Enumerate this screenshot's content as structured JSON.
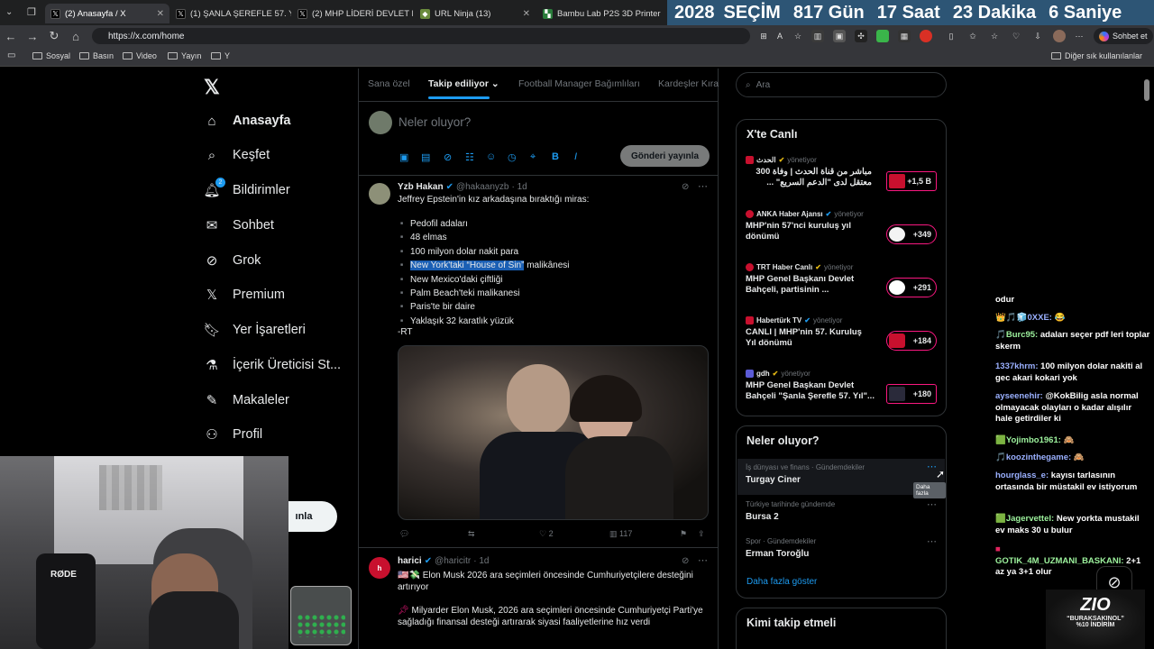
{
  "browser": {
    "tabs": [
      {
        "title": "(2) Anasayfa / X",
        "active": true,
        "favicon": "x-icon"
      },
      {
        "title": "(1) ŞANLA ŞEREFLE 57. YIL /",
        "active": false,
        "favicon": "x-icon"
      },
      {
        "title": "(2) MHP LİDERİ DEVLET BA",
        "active": false,
        "favicon": "x-icon"
      },
      {
        "title": "URL Ninja (13)",
        "active": false,
        "favicon": "ninja-icon"
      },
      {
        "title": "Bambu Lab P2S 3D Printer",
        "active": false,
        "favicon": "bambu-icon"
      }
    ],
    "url": "https://x.com/home",
    "profile_label": "Sohbet et",
    "bookmarks": [
      "Sosyal",
      "Basın",
      "Video",
      "Yayın",
      "Y"
    ],
    "other_bookmarks": "Diğer sık kullanılanlar"
  },
  "countdown": {
    "year": "2028",
    "word": "SEÇİM",
    "parts": [
      "817 Gün",
      "17 Saat",
      "23 Dakika",
      "6 Saniye"
    ]
  },
  "x_nav": {
    "items": [
      {
        "label": "Anasayfa",
        "icon": "home-icon"
      },
      {
        "label": "Keşfet",
        "icon": "search-icon"
      },
      {
        "label": "Bildirimler",
        "icon": "bell-icon",
        "badge": "2"
      },
      {
        "label": "Sohbet",
        "icon": "mail-icon"
      },
      {
        "label": "Grok",
        "icon": "grok-icon"
      },
      {
        "label": "Premium",
        "icon": "x-icon"
      },
      {
        "label": "Yer İşaretleri",
        "icon": "bookmark-icon"
      },
      {
        "label": "İçerik Üreticisi St...",
        "icon": "flask-icon"
      },
      {
        "label": "Makaleler",
        "icon": "article-icon"
      },
      {
        "label": "Profil",
        "icon": "user-icon"
      }
    ],
    "post_button_partial": "ınla"
  },
  "timeline": {
    "tabs": [
      "Sana özel",
      "Takip ediliyor",
      "Football Manager Bağımlıları",
      "Kardeşler Kıra"
    ],
    "compose_placeholder": "Neler oluyor?",
    "post_button": "Gönderi yayınla",
    "tweets": [
      {
        "name": "Yzb Hakan",
        "handle": "@hakaanyzb",
        "time": "· 1d",
        "intro": "Jeffrey Epstein'in kız arkadaşına bıraktığı miras:",
        "bullets": [
          "Pedofil adaları",
          "48 elmas",
          "100 milyon dolar nakit para",
          "New York'taki “House of Sin” malikânesi",
          "New Mexico'daki çiftliği",
          "Palm Beach'teki malikanesi",
          "Paris'te bir daire",
          "Yaklaşık 32 karatlık yüzük"
        ],
        "highlight": "New York'taki “House of Sin”",
        "highlight_rest": " malikânesi",
        "footer": "-RT",
        "likes": "2",
        "views": "117"
      },
      {
        "name": "harici",
        "handle": "@haricitr",
        "time": "· 1d",
        "line1": "Elon Musk 2026 ara seçimleri öncesinde Cumhuriyetçilere desteğini artırıyor",
        "line2": "Milyarder Elon Musk, 2026 ara seçimleri öncesinde Cumhuriyetçi Parti'ye sağladığı finansal desteği artırarak siyasi faaliyetlerine hız verdi"
      }
    ]
  },
  "search_placeholder": "Ara",
  "live": {
    "title": "X'te Canlı",
    "items": [
      {
        "source": "الحدث",
        "sub": "yönetiyor",
        "text": "مباشر من قناة الحدث | وفاة 300 معتقل لدى \"الدعم السريع\" ...",
        "count": "+1,5 B",
        "rtl": true
      },
      {
        "source": "ANKA Haber Ajansı",
        "sub": "yönetiyor",
        "text": "MHP'nin 57'nci kuruluş yıl dönümü",
        "count": "+349"
      },
      {
        "source": "TRT Haber Canlı",
        "sub": "yönetiyor",
        "text": "MHP Genel Başkanı Devlet Bahçeli, partisinin ...",
        "count": "+291"
      },
      {
        "source": "Habertürk TV",
        "sub": "yönetiyor",
        "text": "CANLI | MHP'nin 57. Kuruluş Yıl dönümü",
        "count": "+184"
      },
      {
        "source": "gdh",
        "sub": "yönetiyor",
        "text": "MHP Genel Başkanı Devlet Bahçeli \"Şanla Şerefle 57. Yıl\"...",
        "count": "+180"
      }
    ]
  },
  "trends": {
    "title": "Neler oluyor?",
    "items": [
      {
        "category": "İş dünyası ve finans · Gündemdekiler",
        "name": "Turgay Ciner"
      },
      {
        "category": "Türkiye tarihinde gündemde",
        "name": "Bursa 2"
      },
      {
        "category": "Spor · Gündemdekiler",
        "name": "Erman Toroğlu"
      }
    ],
    "tooltip": "Daha fazla",
    "show_more": "Daha fazla göster"
  },
  "follow_title": "Kimi takip etmeli",
  "chat": [
    {
      "user": "",
      "msg": "odur"
    },
    {
      "user": "0XXE:",
      "msg": "😂",
      "color": "u"
    },
    {
      "user": "Burc95:",
      "msg": "adaları seçer pdf leri toplar skerm",
      "color": "g"
    },
    {
      "user": "1337khrm:",
      "msg": "100 milyon dolar nakiti al gec akari kokari yok",
      "color": "u"
    },
    {
      "user": "ayseenehir:",
      "msg": "@KokBilig asla normal olmayacak olayları o kadar alışılır hale getirdiler ki",
      "color": "u"
    },
    {
      "user": "Yojimbo1961:",
      "msg": "🙈",
      "color": "g"
    },
    {
      "user": "koozinthegame:",
      "msg": "🙈",
      "color": "u"
    },
    {
      "user": "hourglass_e:",
      "msg": "kayısı tarlasının ortasında bir müstakil ev istiyorum",
      "color": "u"
    },
    {
      "user": "Jagervettel:",
      "msg": "New yorkta mustakil ev maks 30 u bulur",
      "color": "g"
    },
    {
      "user": "GOTIK_4M_UZMANI_BASKANI:",
      "msg": "2+1 az ya 3+1 olur",
      "color": "g"
    }
  ],
  "sponsor": {
    "logo": "ZIO",
    "code": "“BURAKSAKINOL”",
    "discount": "%10 İNDİRİM"
  },
  "webcam": {
    "mic_brand": "RØDE"
  }
}
